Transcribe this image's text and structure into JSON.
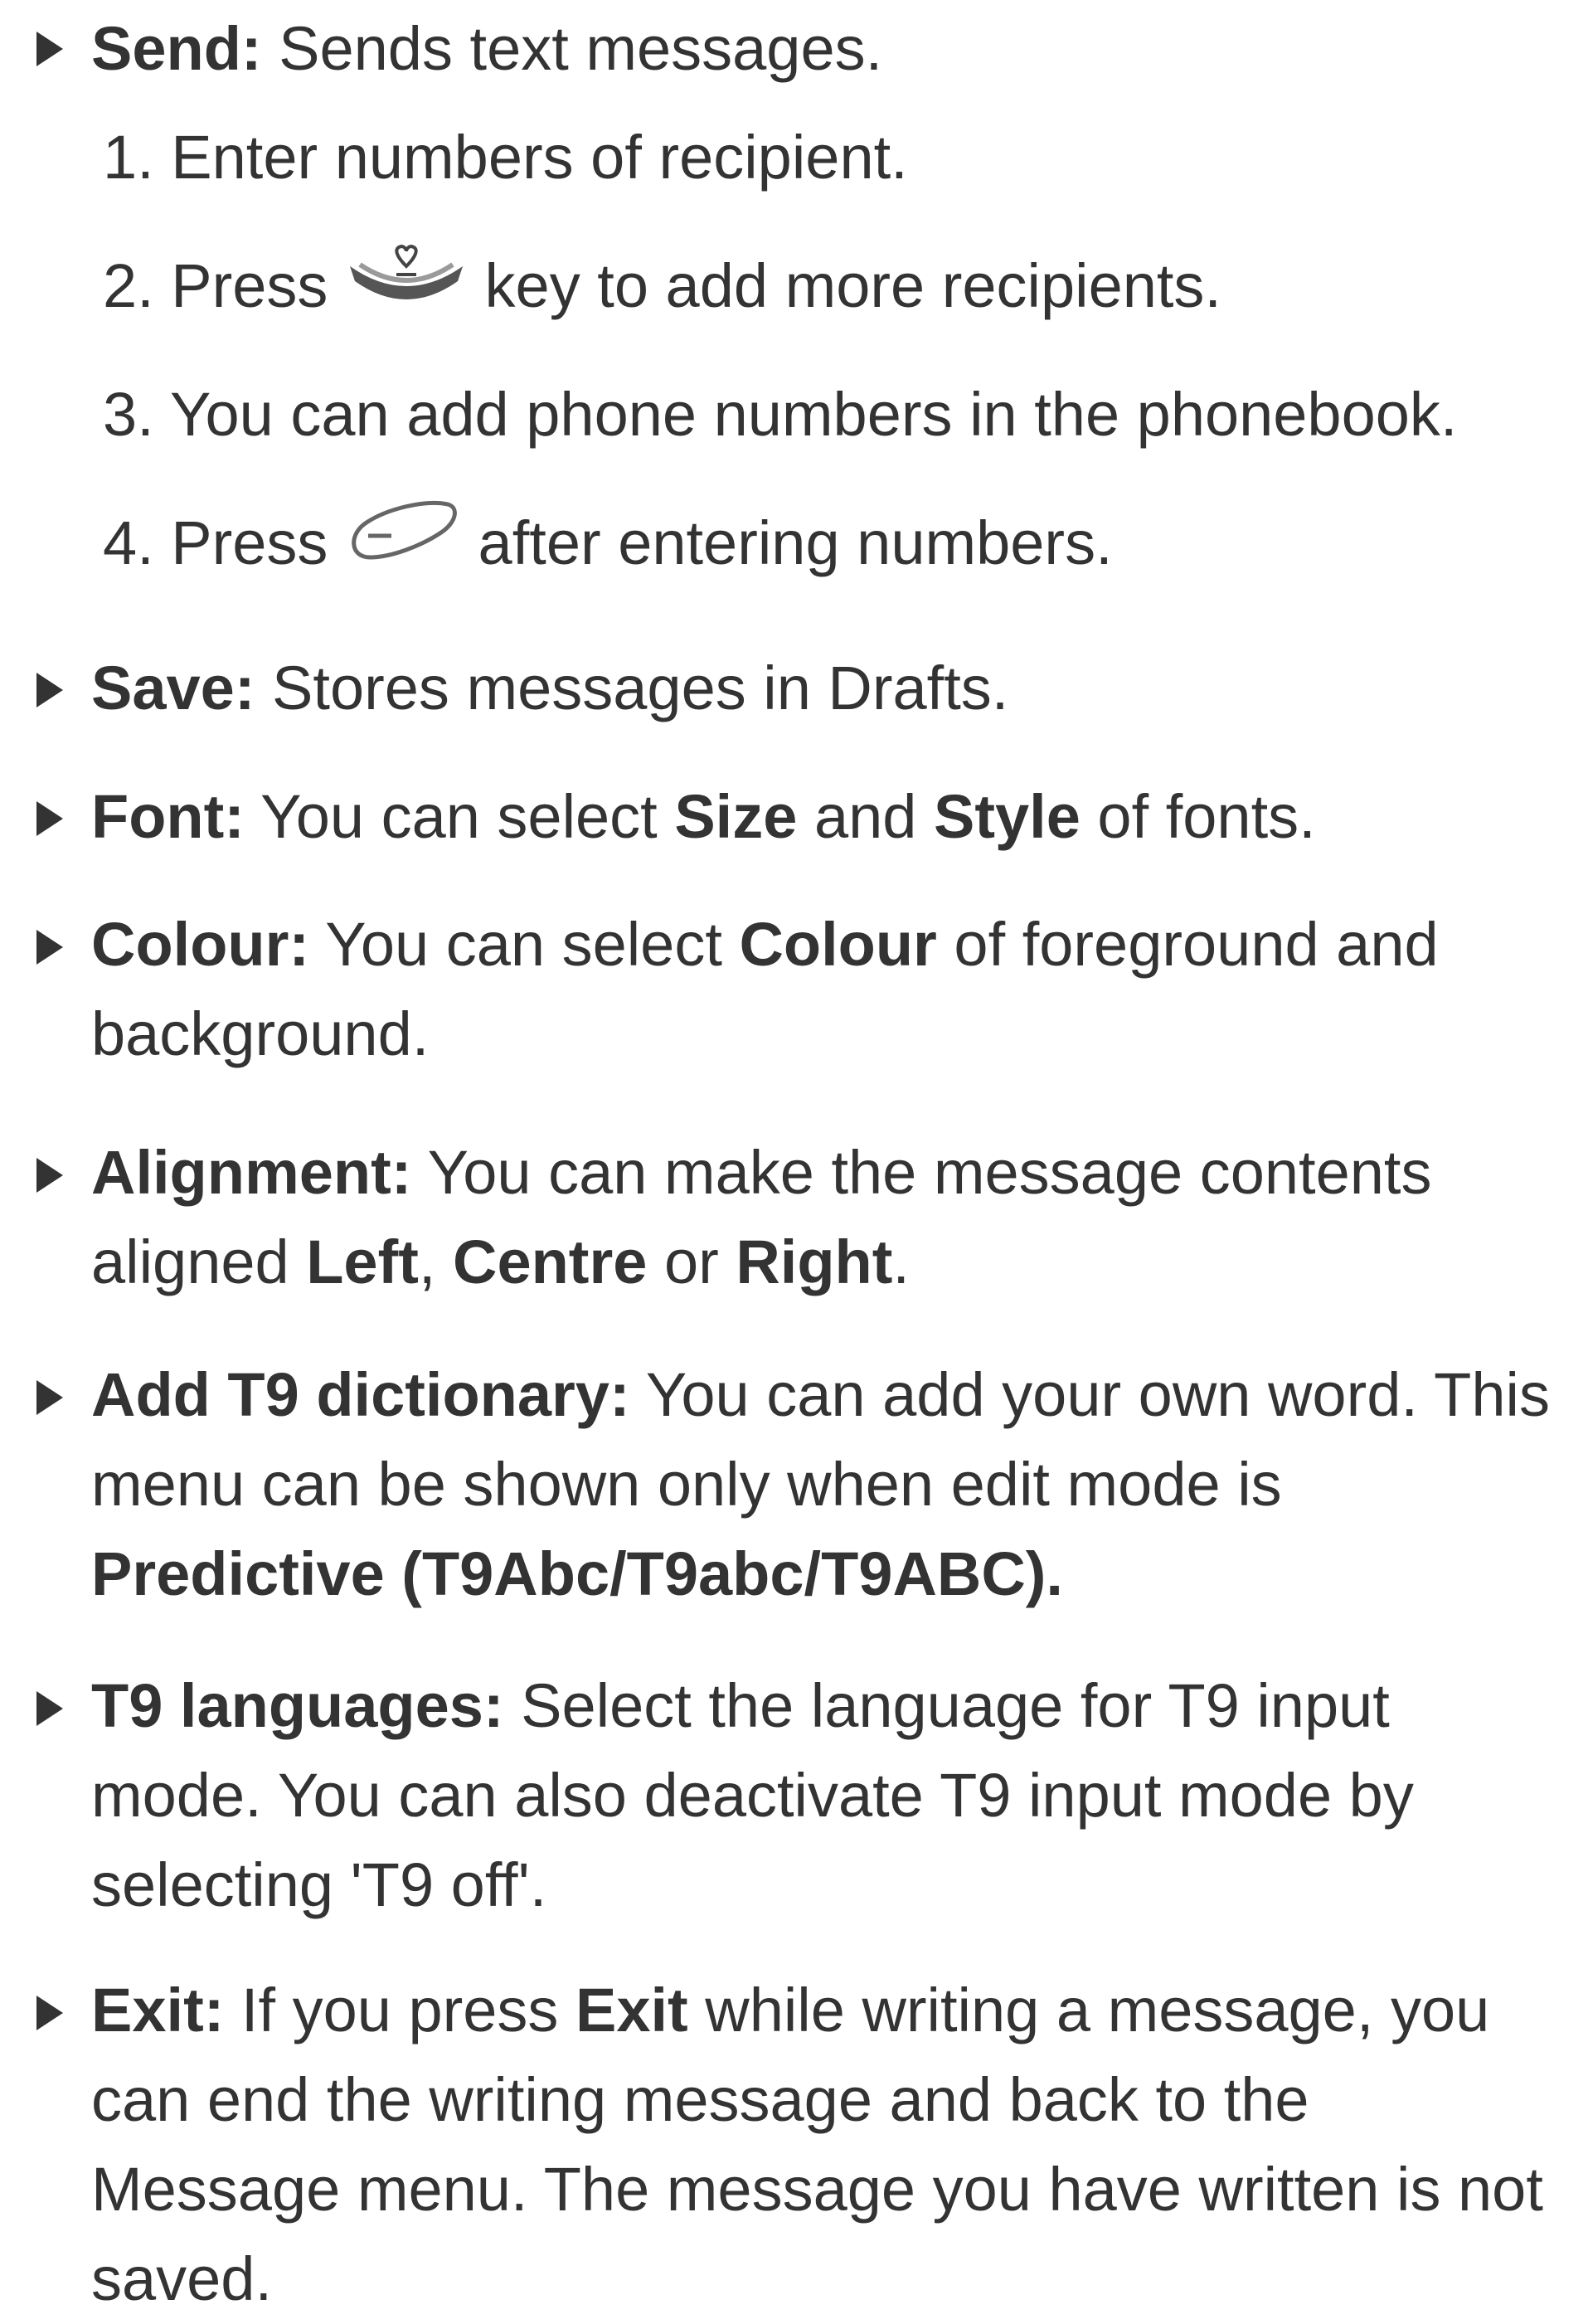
{
  "send": {
    "term": "Send:",
    "desc": " Sends text messages.",
    "steps": [
      {
        "num": "1.",
        "before": " Enter numbers of recipient.",
        "icon": "",
        "after": ""
      },
      {
        "num": "2.",
        "before": " Press ",
        "icon": "nav-key-down-icon",
        "after": " key to add more recipients."
      },
      {
        "num": "3.",
        "before": " You can add phone numbers in the phonebook.",
        "icon": "",
        "after": ""
      },
      {
        "num": "4.",
        "before": " Press ",
        "icon": "soft-key-left-icon",
        "after": " after entering numbers."
      }
    ]
  },
  "save": {
    "term": "Save:",
    "desc": " Stores messages in Drafts."
  },
  "font": {
    "term": "Font:",
    "p1": " You can select ",
    "b1": "Size",
    "p2": " and ",
    "b2": "Style",
    "p3": " of fonts."
  },
  "colour": {
    "term": "Colour:",
    "p1": " You can select ",
    "b1": "Colour",
    "p2": " of foreground and background."
  },
  "alignment": {
    "term": "Alignment:",
    "p1": " You can make the message contents aligned ",
    "b1": "Left",
    "p2": ", ",
    "b2": "Centre",
    "p3": " or ",
    "b3": "Right",
    "p4": "."
  },
  "t9dict": {
    "term": "Add T9 dictionary:",
    "p1": " You can add your own word. This menu can be shown only when edit mode is ",
    "b1": "Predictive (T9Abc/T9abc/T9ABC)."
  },
  "t9lang": {
    "term": "T9 languages:",
    "p1": " Select the language for T9 input mode. You can also deactivate T9 input mode by selecting 'T9 off'."
  },
  "exit": {
    "term": "Exit:",
    "p1": " If you press ",
    "b1": "Exit",
    "p2": " while writing a message, you can end the writing message and back to the Message menu. The message you have written is not saved."
  }
}
